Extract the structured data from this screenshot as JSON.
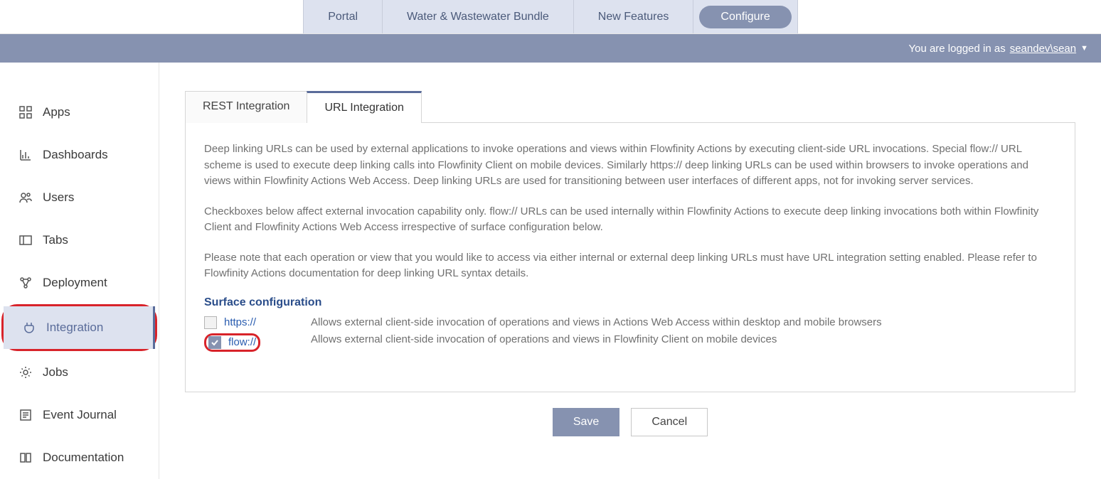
{
  "topnav": {
    "tabs": [
      {
        "label": "Portal"
      },
      {
        "label": "Water & Wastewater Bundle"
      },
      {
        "label": "New Features"
      },
      {
        "label": "Configure"
      }
    ]
  },
  "loginbar": {
    "prefix": "You are logged in as",
    "user": "seandev\\sean"
  },
  "sidebar": {
    "items": [
      {
        "label": "Apps"
      },
      {
        "label": "Dashboards"
      },
      {
        "label": "Users"
      },
      {
        "label": "Tabs"
      },
      {
        "label": "Deployment"
      },
      {
        "label": "Integration"
      },
      {
        "label": "Jobs"
      },
      {
        "label": "Event Journal"
      },
      {
        "label": "Documentation"
      }
    ]
  },
  "panel": {
    "tabs": {
      "rest": "REST Integration",
      "url": "URL Integration"
    },
    "p1": "Deep linking URLs can be used by external applications to invoke operations and views within Flowfinity Actions by executing client-side URL invocations. Special flow:// URL scheme is used to execute deep linking calls into Flowfinity Client on mobile devices. Similarly https:// deep linking URLs can be used within browsers to invoke operations and views within Flowfinity Actions Web Access. Deep linking URLs are used for transitioning between user interfaces of different apps, not for invoking server services.",
    "p2": "Checkboxes below affect external invocation capability only. flow:// URLs can be used internally within Flowfinity Actions to execute deep linking invocations both within Flowfinity Client and Flowfinity Actions Web Access irrespective of surface configuration below.",
    "p3": "Please note that each operation or view that you would like to access via either internal or external deep linking URLs must have URL integration setting enabled. Please refer to Flowfinity Actions documentation for deep linking URL syntax details.",
    "section_head": "Surface configuration",
    "rows": {
      "https": {
        "label": "https://",
        "desc": "Allows external client-side invocation of operations and views in Actions Web Access within desktop and mobile browsers",
        "checked": false
      },
      "flow": {
        "label": "flow://",
        "desc": "Allows external client-side invocation of operations and views in Flowfinity Client on mobile devices",
        "checked": true
      }
    }
  },
  "actions": {
    "save": "Save",
    "cancel": "Cancel"
  }
}
